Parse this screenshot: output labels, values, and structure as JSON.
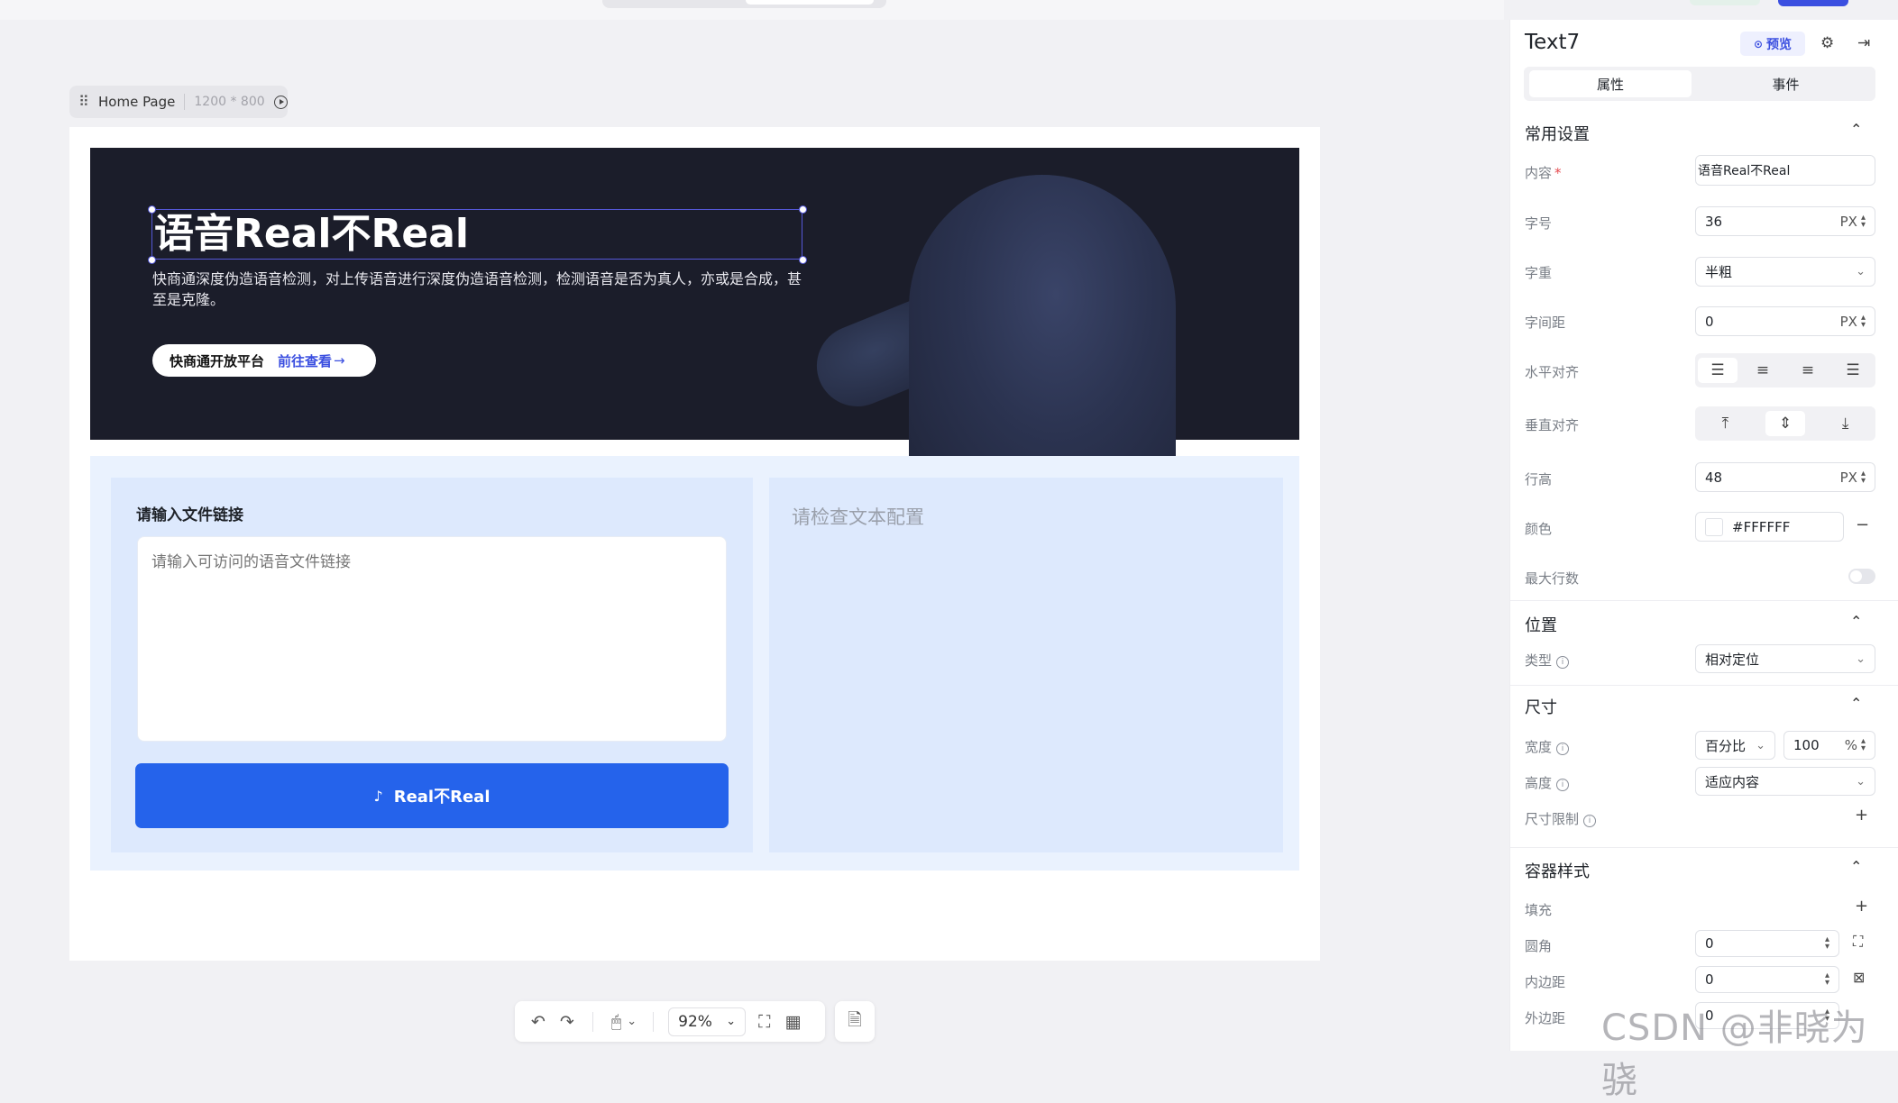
{
  "page_tab": {
    "name": "Home Page",
    "size": "1200 * 800"
  },
  "banner": {
    "title": "语音Real不Real",
    "description": "快商通深度伪造语音检测，对上传语音进行深度伪造语音检测，检测语音是否为真人，亦或是合成，甚至是克隆。",
    "brand": "快商通开放平台",
    "link": "前往查看"
  },
  "form": {
    "input_label": "请输入文件链接",
    "input_placeholder": "请输入可访问的语音文件链接",
    "submit_label": "Real不Real",
    "result_placeholder": "请检查文本配置"
  },
  "toolbar": {
    "zoom": "92%"
  },
  "panel": {
    "title": "Text7",
    "preview": "预览",
    "tabs": [
      "属性",
      "事件"
    ],
    "common": {
      "section": "常用设置",
      "content_label": "内容",
      "content_value": "语音Real不Real",
      "font_size_label": "字号",
      "font_size_value": "36",
      "font_weight_label": "字重",
      "font_weight_value": "半粗",
      "letter_spacing_label": "字间距",
      "letter_spacing_value": "0",
      "h_align_label": "水平对齐",
      "v_align_label": "垂直对齐",
      "line_height_label": "行高",
      "line_height_value": "48",
      "color_label": "颜色",
      "color_value": "#FFFFFF",
      "max_lines_label": "最大行数",
      "unit_px": "PX"
    },
    "position": {
      "section": "位置",
      "type_label": "类型",
      "type_value": "相对定位"
    },
    "size": {
      "section": "尺寸",
      "width_label": "宽度",
      "width_mode": "百分比",
      "width_value": "100",
      "width_unit": "%",
      "height_label": "高度",
      "height_value": "适应内容",
      "limit_label": "尺寸限制"
    },
    "container": {
      "section": "容器样式",
      "fill_label": "填充",
      "radius_label": "圆角",
      "radius_value": "0",
      "padding_label": "内边距",
      "padding_value": "0",
      "margin_label": "外边距",
      "margin_value": "0"
    }
  },
  "watermark": "CSDN @非晓为骁"
}
